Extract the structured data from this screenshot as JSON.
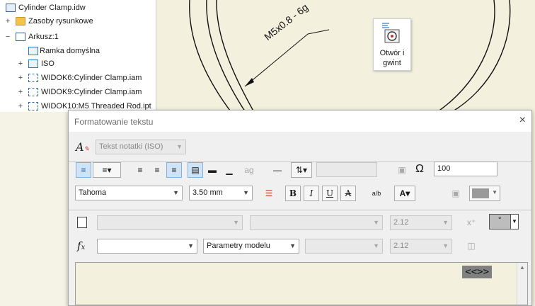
{
  "tree": {
    "items": [
      {
        "label": "Cylinder Clamp.idw",
        "icon": "drawing-file-icon",
        "expander": ""
      },
      {
        "label": "Zasoby rysunkowe",
        "icon": "folder-icon",
        "expander": "+"
      },
      {
        "label": "Arkusz:1",
        "icon": "sheet-icon",
        "expander": "−"
      },
      {
        "label": "Ramka domyślna",
        "icon": "frame-icon",
        "expander": ""
      },
      {
        "label": "ISO",
        "icon": "title-block-icon",
        "expander": "+"
      },
      {
        "label": "WIDOK6:Cylinder Clamp.iam",
        "icon": "view-icon",
        "expander": "+"
      },
      {
        "label": "WIDOK9:Cylinder Clamp.iam",
        "icon": "view-icon",
        "expander": "+"
      },
      {
        "label": "WIDOK10:M5 Threaded Rod.ipt",
        "icon": "view-icon",
        "expander": "+"
      }
    ]
  },
  "canvas": {
    "dimension_label": "M5x0.8 - 6g"
  },
  "tooltip": {
    "label_line1": "Otwór i",
    "label_line2": "gwint",
    "icon": "hole-thread-icon"
  },
  "dialog": {
    "title": "Formatowanie tekstu",
    "close_glyph": "×",
    "style_value": "Tekst notatki (ISO)",
    "font_value": "Tahoma",
    "size_value": "3.50 mm",
    "width_scale_value": "100",
    "bold_label": "B",
    "italic_label": "I",
    "underline_label": "U",
    "strike_label": "A",
    "row3": {
      "combo_a": "",
      "combo_b": "",
      "precision_value": "2.12",
      "symbol_value": "°"
    },
    "row4": {
      "combo_a": "",
      "parameters_value": "Parametry modelu",
      "combo_c": "",
      "precision_value": "2.12"
    },
    "edit_field_text": "<<>>",
    "colors": {
      "accent": "#cfe3f7",
      "canvas": "#f3f1de",
      "field_highlight": "#808080"
    }
  }
}
